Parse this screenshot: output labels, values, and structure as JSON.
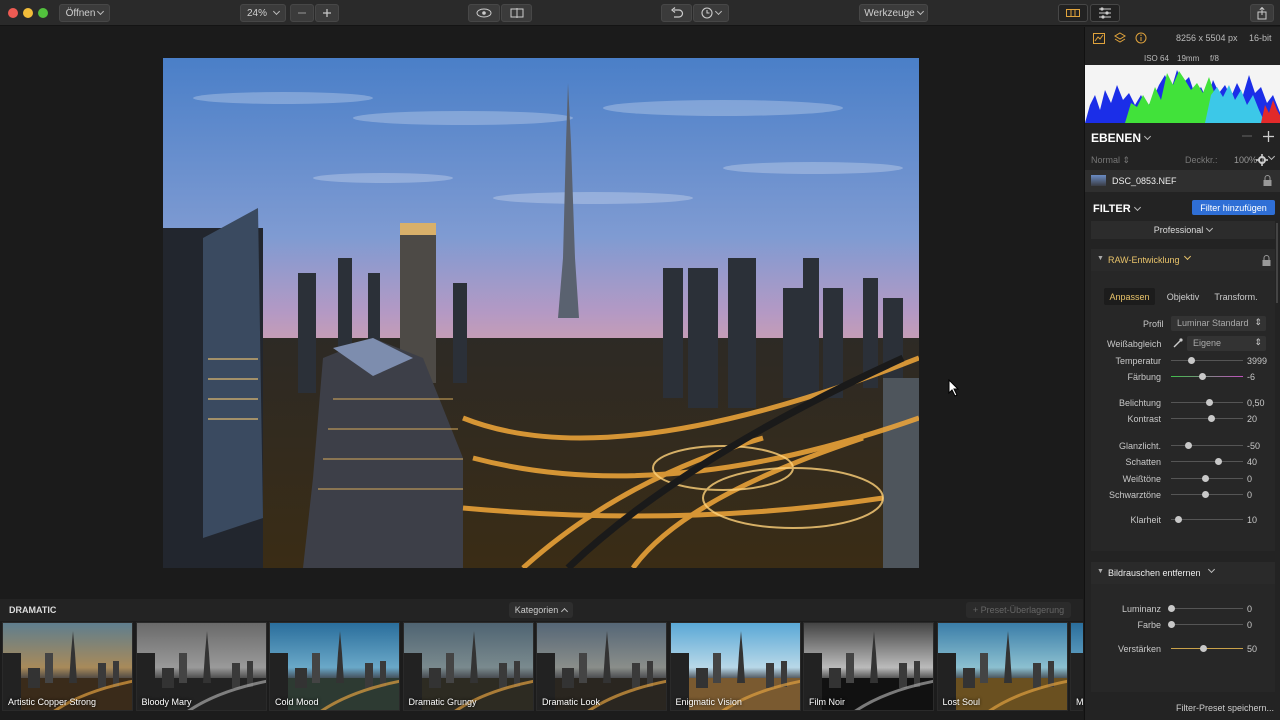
{
  "toolbar": {
    "open_label": "Öffnen",
    "zoom_value": "24%",
    "tools_label": "Werkzeuge"
  },
  "image_info": {
    "dimensions": "8256 x 5504 px",
    "bit_depth": "16-bit",
    "iso": "ISO 64",
    "focal": "19mm",
    "aperture": "f/8"
  },
  "layers": {
    "title": "EBENEN",
    "blend_mode": "Normal",
    "opacity_label": "Deckkr.:",
    "opacity_value": "100%",
    "layer_name": "DSC_0853.NEF"
  },
  "filter": {
    "title": "FILTER",
    "add_label": "Filter hinzufügen",
    "workspace": "Professional",
    "raw_title": "RAW-Entwicklung",
    "tabs": [
      "Anpassen",
      "Objektiv",
      "Transform."
    ],
    "profile_label": "Profil",
    "profile_value": "Luminar Standard",
    "wb_label": "Weißabgleich",
    "wb_value": "Eigene",
    "sliders": [
      {
        "name": "Temperatur",
        "value": "3999",
        "pos": 0.28
      },
      {
        "name": "Färbung",
        "value": "-6",
        "pos": 0.43
      },
      {
        "name": "Belichtung",
        "value": "0,50",
        "pos": 0.53
      },
      {
        "name": "Kontrast",
        "value": "20",
        "pos": 0.55
      },
      {
        "name": "Glanzlicht.",
        "value": "-50",
        "pos": 0.23
      },
      {
        "name": "Schatten",
        "value": "40",
        "pos": 0.65
      },
      {
        "name": "Weißtöne",
        "value": "0",
        "pos": 0.47
      },
      {
        "name": "Schwarztöne",
        "value": "0",
        "pos": 0.47
      },
      {
        "name": "Klarheit",
        "value": "10",
        "pos": 0.1
      }
    ],
    "noise_title": "Bildrauschen entfernen",
    "noise_sliders": [
      {
        "name": "Luminanz",
        "value": "0",
        "pos": 0.0
      },
      {
        "name": "Farbe",
        "value": "0",
        "pos": 0.0
      },
      {
        "name": "Verstärken",
        "value": "50",
        "pos": 0.45
      }
    ],
    "save_preset": "Filter-Preset speichern..."
  },
  "presets": {
    "category": "DRAMATIC",
    "categories_label": "Kategorien",
    "overlay_label": "+ Preset-Überlagerung",
    "items": [
      {
        "label": "Artistic Copper Strong",
        "style": "copper"
      },
      {
        "label": "Bloody Mary",
        "style": "mono"
      },
      {
        "label": "Cold Mood",
        "style": "cold"
      },
      {
        "label": "Dramatic Grungy",
        "style": "grungy"
      },
      {
        "label": "Dramatic Look",
        "style": "look"
      },
      {
        "label": "Enigmatic Vision",
        "style": "vision"
      },
      {
        "label": "Film Noir",
        "style": "noir"
      },
      {
        "label": "Lost Soul",
        "style": "soul"
      },
      {
        "label": "M",
        "style": "cold"
      }
    ]
  },
  "colors": {
    "accent": "#2f6fd6",
    "panel": "#232323",
    "raw_title": "#e8c36a"
  }
}
